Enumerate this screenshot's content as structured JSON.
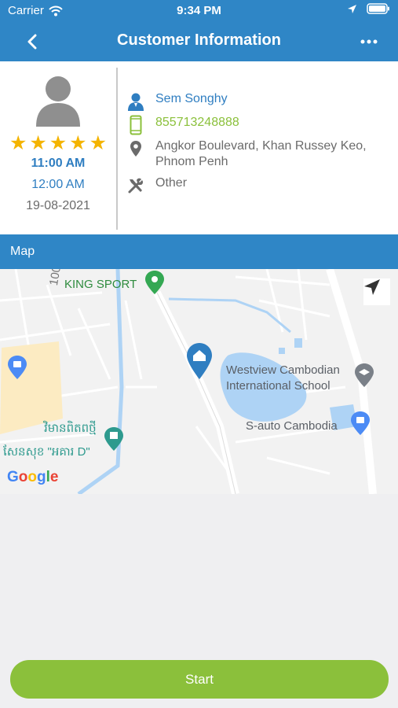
{
  "status_bar": {
    "carrier": "Carrier",
    "time": "9:34 PM",
    "wifi_icon": "wifi-icon",
    "location_icon": "location-arrow-icon",
    "battery_icon": "battery-icon"
  },
  "nav": {
    "title": "Customer Information",
    "back_icon": "chevron-left-icon",
    "more_icon": "more-dots-icon"
  },
  "customer": {
    "rating": 5,
    "rating_max": 5,
    "time_start": "11:00 AM",
    "time_end": "12:00 AM",
    "date": "19-08-2021",
    "name": "Sem Songhy",
    "phone": "855713248888",
    "address": "Angkor Boulevard, Khan Russey Keo, Phnom Penh",
    "service_type": "Other"
  },
  "map": {
    "header": "Map",
    "labels": {
      "king_sport": "KING SPORT",
      "westview_line1": "Westview Cambodian",
      "westview_line2": "International School",
      "s_auto": "S-auto Cambodia",
      "khmer1": "វិមានពិតពថ្មី",
      "khmer2": "សែនសុខ \"អគារ D\"",
      "street": "100"
    },
    "google": [
      "G",
      "o",
      "o",
      "g",
      "l",
      "e"
    ]
  },
  "colors": {
    "primary": "#2f86c6",
    "accent_green": "#8bc03b",
    "star": "#f4b400",
    "link_blue": "#2f7ec1"
  },
  "actions": {
    "start_label": "Start"
  }
}
